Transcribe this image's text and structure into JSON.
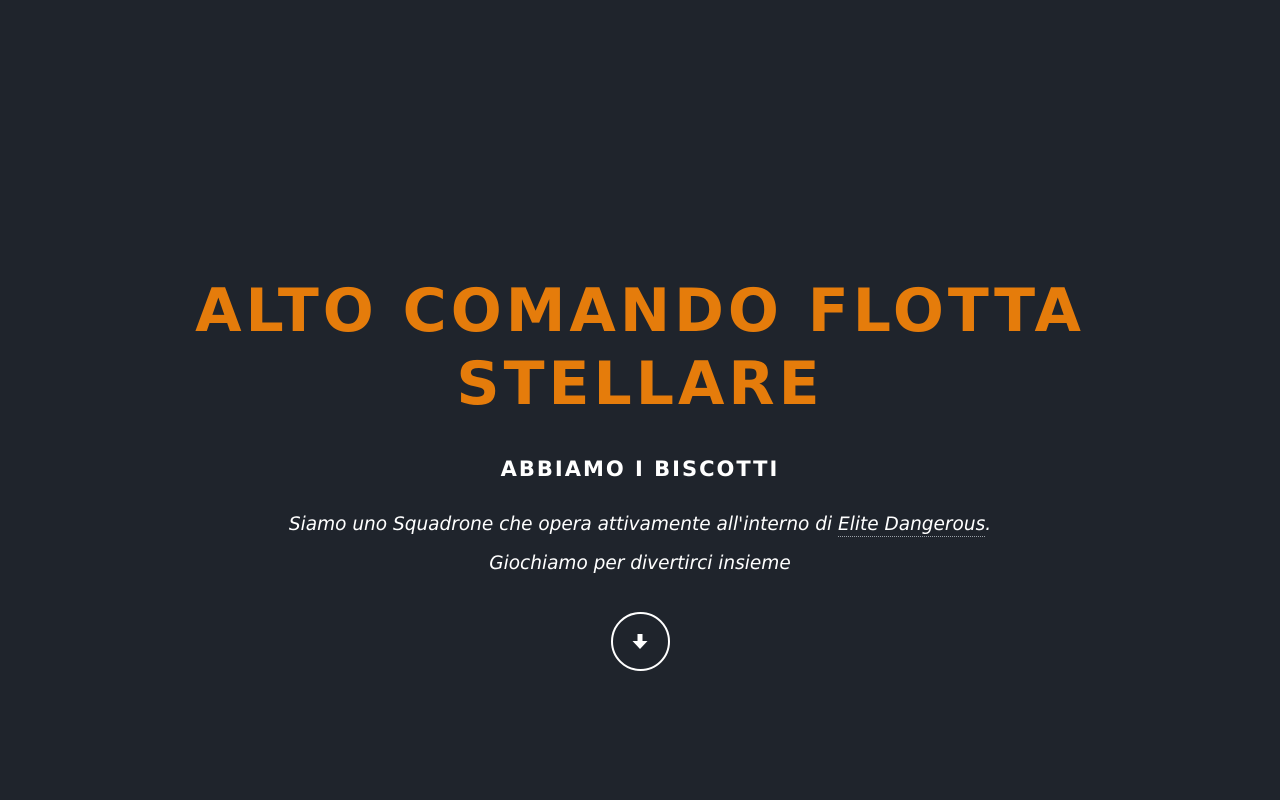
{
  "hero": {
    "title": "ALTO COMANDO FLOTTA STELLARE",
    "subtitle": "ABBIAMO I BISCOTTI",
    "line1_prefix": "Siamo uno Squadrone che opera attivamente all'interno di ",
    "line1_link": "Elite Dangerous",
    "line1_suffix": ".",
    "line2": "Giochiamo per divertirci insieme",
    "scroll_icon": "arrow-down-icon"
  },
  "colors": {
    "background": "#1f242c",
    "accent": "#e57c0b",
    "text": "#ffffff"
  }
}
